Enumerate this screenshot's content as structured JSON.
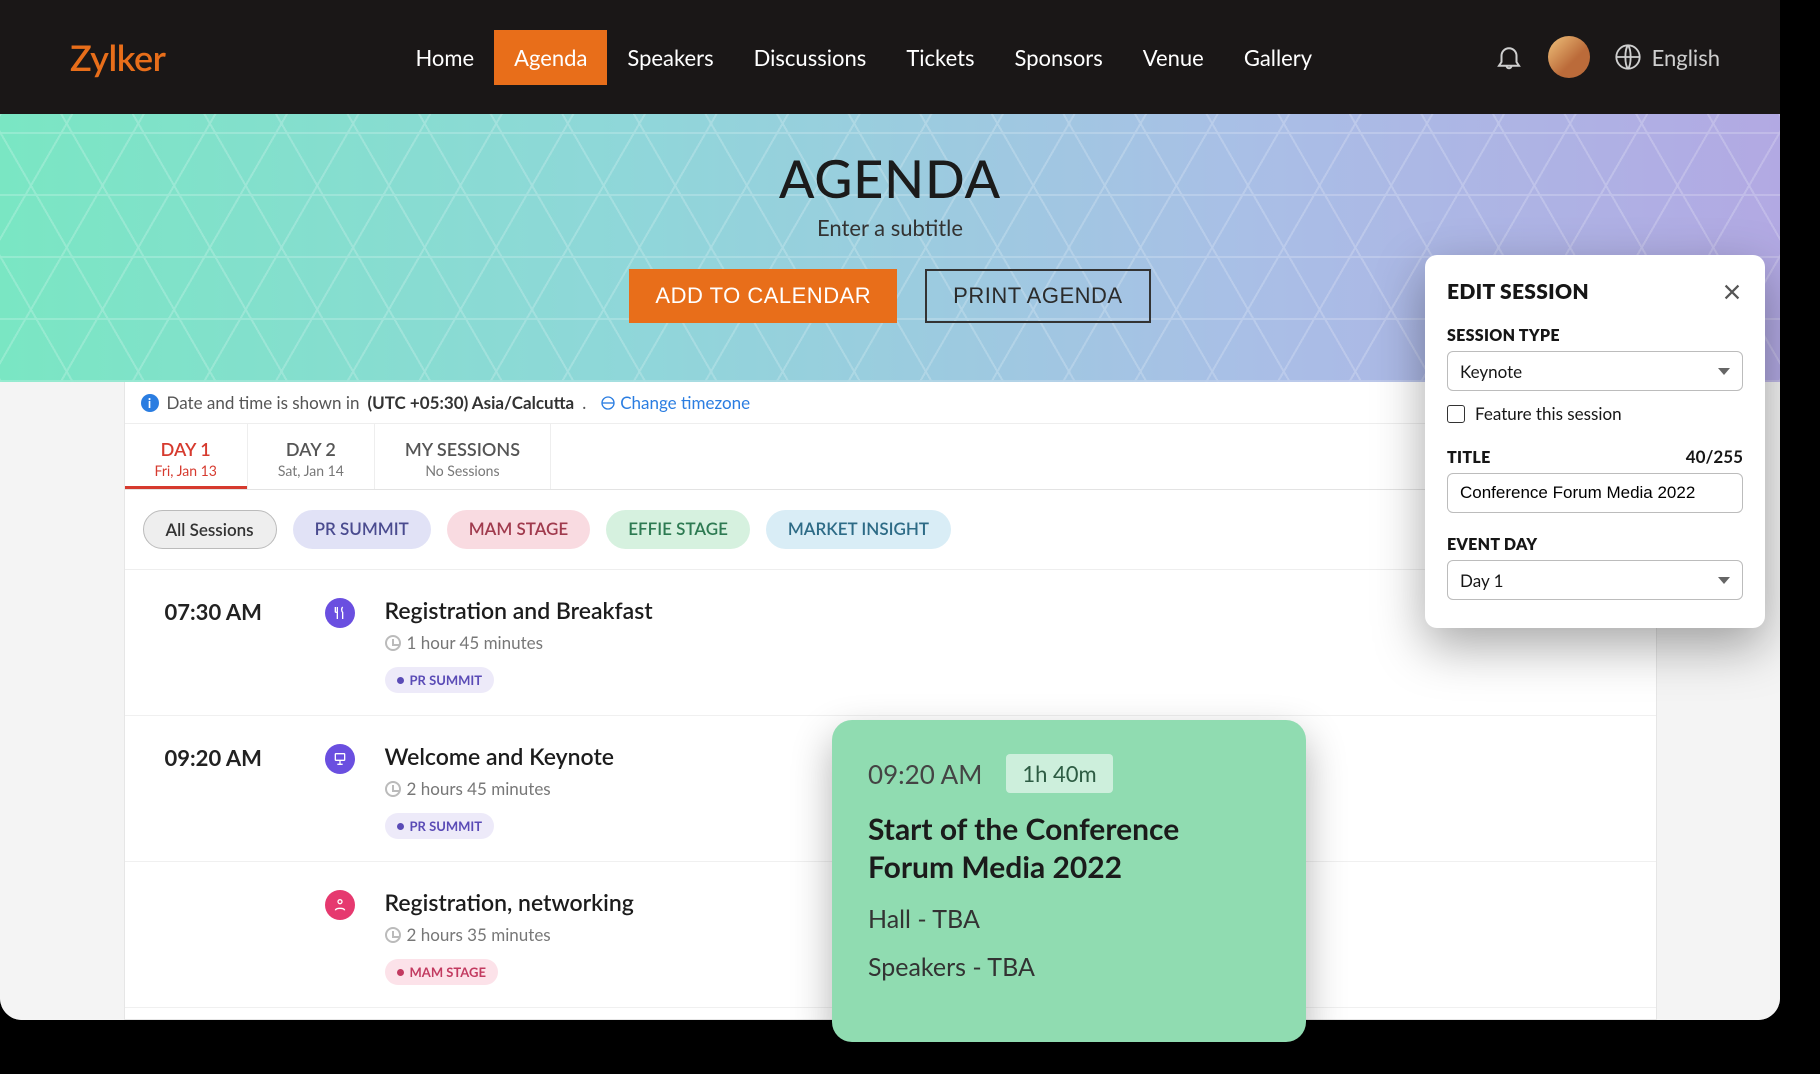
{
  "brand": "Zylker",
  "nav": {
    "items": [
      "Home",
      "Agenda",
      "Speakers",
      "Discussions",
      "Tickets",
      "Sponsors",
      "Venue",
      "Gallery"
    ],
    "active": "Agenda"
  },
  "language": "English",
  "hero": {
    "title": "AGENDA",
    "subtitle": "Enter a subtitle",
    "add_to_calendar": "ADD TO CALENDAR",
    "print_agenda": "PRINT AGENDA"
  },
  "tzbar": {
    "prefix": "Date and time is shown in ",
    "tz": "(UTC +05:30) Asia/Calcutta",
    "suffix": ".",
    "change": "Change timezone"
  },
  "day_tabs": [
    {
      "label": "DAY 1",
      "sub": "Fri, Jan 13",
      "active": true
    },
    {
      "label": "DAY 2",
      "sub": "Sat, Jan 14"
    },
    {
      "label": "MY SESSIONS",
      "sub": "No Sessions"
    }
  ],
  "tracks": {
    "all": "All Sessions",
    "pr": "PR SUMMIT",
    "mam": "MAM STAGE",
    "effie": "EFFIE STAGE",
    "market": "MARKET INSIGHT"
  },
  "sessions": [
    {
      "time": "07:30 AM",
      "title": "Registration and Breakfast",
      "duration": "1 hour 45 minutes",
      "tag": "PR SUMMIT",
      "icon": "food",
      "tag_style": "purple"
    },
    {
      "time": "09:20 AM",
      "title": "Welcome and Keynote",
      "duration": "2 hours 45 minutes",
      "tag": "PR SUMMIT",
      "icon": "keynote",
      "tag_style": "purple"
    },
    {
      "time": "",
      "title": "Registration, networking",
      "duration": "2 hours 35 minutes",
      "tag": "MAM STAGE",
      "icon": "network",
      "tag_style": "pink"
    }
  ],
  "float_card": {
    "time": "09:20 AM",
    "duration": "1h 40m",
    "title": "Start of the Conference Forum Media 2022",
    "hall": "Hall - TBA",
    "speakers": "Speakers - TBA"
  },
  "edit_panel": {
    "heading": "EDIT SESSION",
    "session_type_label": "SESSION TYPE",
    "session_type_value": "Keynote",
    "feature_label": "Feature this session",
    "title_label": "TITLE",
    "title_count": "40/255",
    "title_value": "Conference Forum Media 2022",
    "event_day_label": "EVENT DAY",
    "event_day_value": "Day 1"
  }
}
